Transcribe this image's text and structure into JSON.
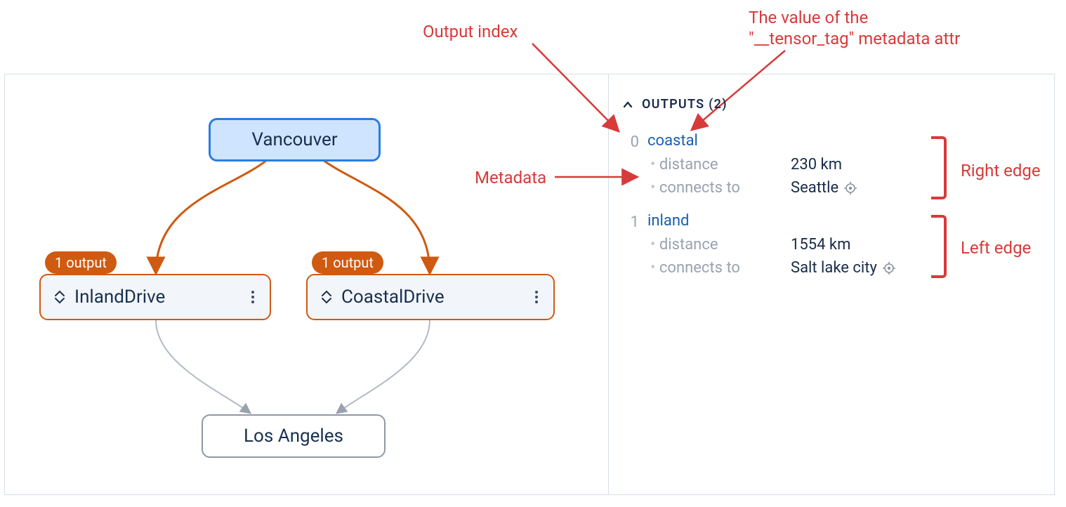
{
  "annotations": {
    "output_index": "Output index",
    "tensor_tag": "The value of the\n\"__tensor_tag\" metadata attr",
    "metadata": "Metadata",
    "right_edge": "Right edge",
    "left_edge": "Left edge"
  },
  "graph": {
    "nodes": {
      "vancouver": "Vancouver",
      "inland": "InlandDrive",
      "coastal": "CoastalDrive",
      "la": "Los Angeles"
    },
    "badges": {
      "inland": "1 output",
      "coastal": "1 output"
    }
  },
  "outputs": {
    "header": "OUTPUTS (2)",
    "items": [
      {
        "index": "0",
        "tag": "coastal",
        "distance_label": "distance",
        "distance_value": "230 km",
        "connects_label": "connects to",
        "connects_value": "Seattle"
      },
      {
        "index": "1",
        "tag": "inland",
        "distance_label": "distance",
        "distance_value": "1554 km",
        "connects_label": "connects to",
        "connects_value": "Salt lake city"
      }
    ]
  }
}
